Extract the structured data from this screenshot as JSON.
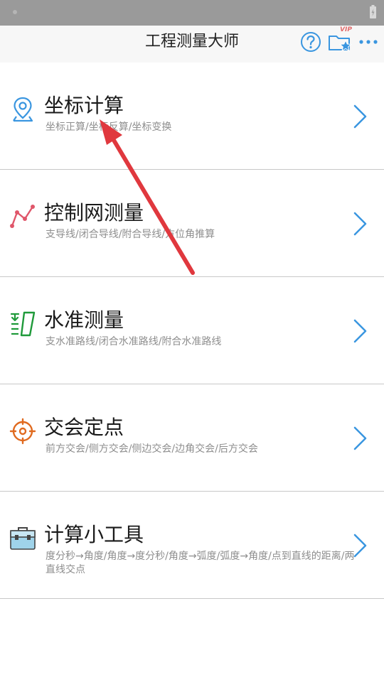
{
  "header": {
    "title": "工程测量大师",
    "vip_badge": "VIP",
    "help_icon": "help-circle-icon",
    "vip_icon": "folder-star-icon",
    "more_icon": "more-horizontal-icon"
  },
  "colors": {
    "accent": "#3a96e0",
    "status_bar": "#9a9a9a",
    "annotation_arrow": "#e0383e"
  },
  "menu": {
    "items": [
      {
        "title": "坐标计算",
        "subtitle": "坐标正算/坐标反算/坐标变换",
        "icon": "location-pin-icon"
      },
      {
        "title": "控制网测量",
        "subtitle": "支导线/闭合导线/附合导线/方位角推算",
        "icon": "traverse-line-icon"
      },
      {
        "title": "水准测量",
        "subtitle": "支水准路线/闭合水准路线/附合水准路线",
        "icon": "leveling-staff-icon"
      },
      {
        "title": "交会定点",
        "subtitle": "前方交会/侧方交会/侧边交会/边角交会/后方交会",
        "icon": "crosshair-target-icon"
      },
      {
        "title": "计算小工具",
        "subtitle": "度分秒→角度/角度→度分秒/角度→弧度/弧度→角度/点到直线的距离/两直线交点",
        "icon": "toolbox-icon"
      }
    ]
  }
}
